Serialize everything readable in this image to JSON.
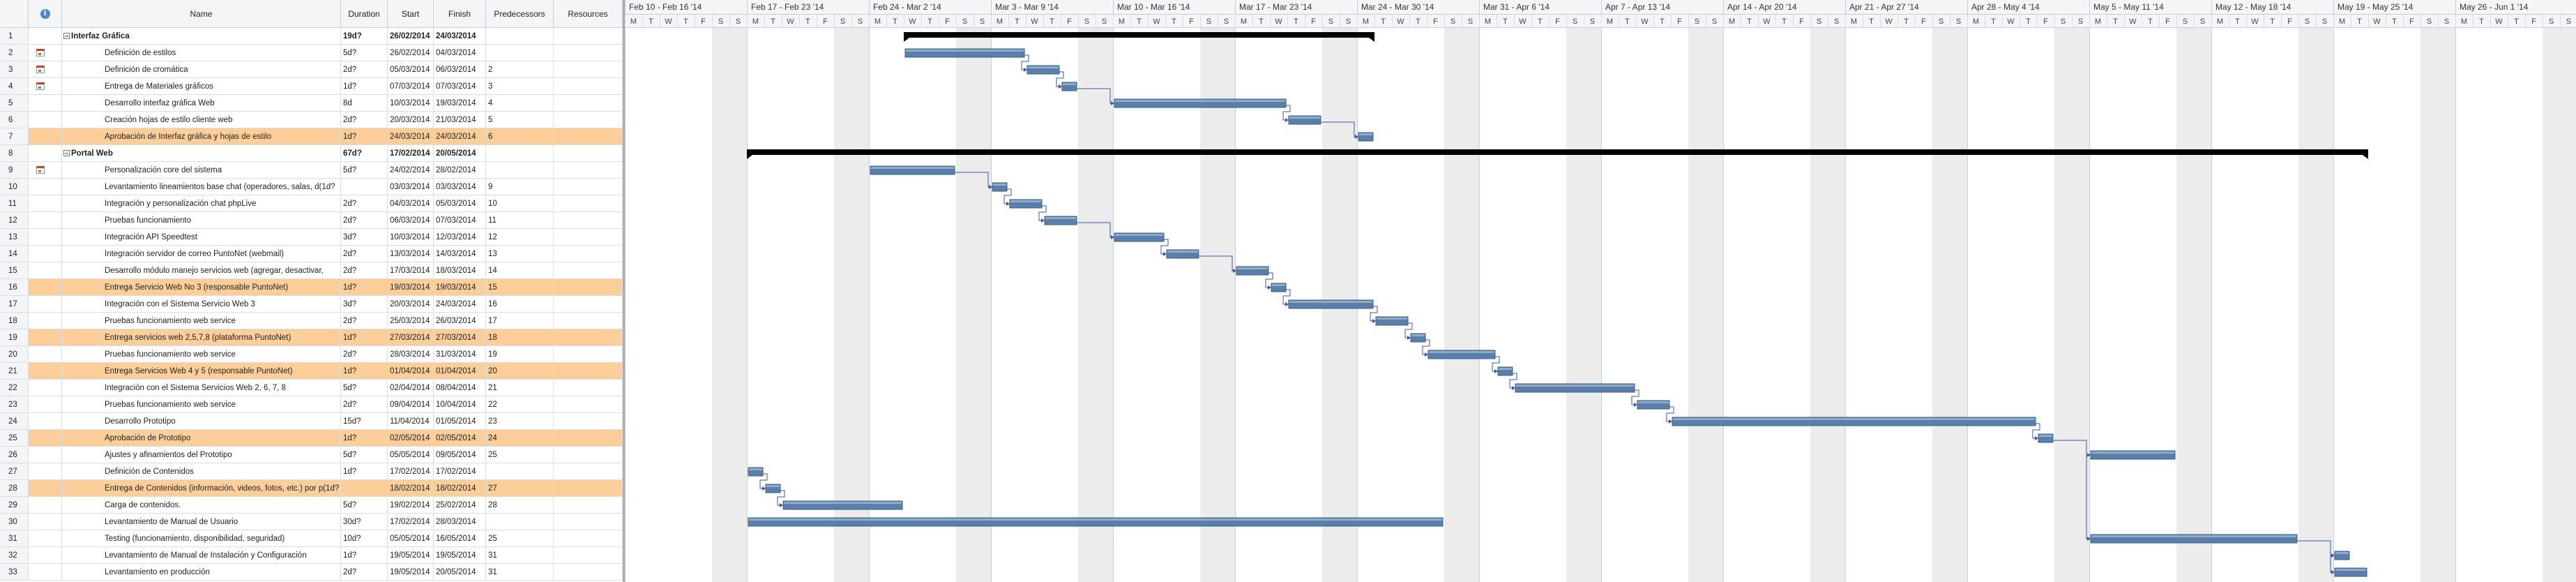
{
  "header": {
    "id_col": "",
    "info_icon": "i",
    "name_col": "Name",
    "duration_col": "Duration",
    "start_col": "Start",
    "finish_col": "Finish",
    "pred_col": "Predecessors",
    "res_col": "Resources"
  },
  "icons": {
    "info": "info-icon",
    "indicator": "calendar-note-icon",
    "collapse": "collapse-toggle-icon"
  },
  "colors": {
    "selected_row": "#fccf9a",
    "task_bar": "#5a7fa8",
    "summary_bar": "#000000",
    "weekend": "#ececec",
    "link": "#3e57a3"
  },
  "timeline": {
    "weeks": [
      "Feb 10 - Feb 16 '14",
      "Feb 17 - Feb 23 '14",
      "Feb 24 - Mar 2 '14",
      "Mar 3 - Mar 9 '14",
      "Mar 10 - Mar 16 '14",
      "Mar 17 - Mar 23 '14",
      "Mar 24 - Mar 30 '14",
      "Mar 31 - Apr 6 '14",
      "Apr 7 - Apr 13 '14",
      "Apr 14 - Apr 20 '14",
      "Apr 21 - Apr 27 '14",
      "Apr 28 - May 4 '14",
      "May 5 - May 11 '14",
      "May 12 - May 18 '14",
      "May 19 - May 25 '14",
      "May 26 - Jun 1 '14"
    ],
    "days": [
      "M",
      "T",
      "W",
      "T",
      "F",
      "S",
      "S"
    ],
    "first_day": "2014-02-10"
  },
  "rows": [
    {
      "id": "1",
      "name": "Interfaz Gráfica",
      "duration": "19d?",
      "start": "26/02/2014",
      "finish": "24/03/2014",
      "pred": "",
      "res": "",
      "summary": true,
      "indicator": false,
      "sel": false
    },
    {
      "id": "2",
      "name": "Definición de estilos",
      "duration": "5d?",
      "start": "26/02/2014",
      "finish": "04/03/2014",
      "pred": "",
      "res": "",
      "summary": false,
      "indicator": true,
      "sel": false
    },
    {
      "id": "3",
      "name": "Definición de cromática",
      "duration": "2d?",
      "start": "05/03/2014",
      "finish": "06/03/2014",
      "pred": "2",
      "res": "",
      "summary": false,
      "indicator": true,
      "sel": false
    },
    {
      "id": "4",
      "name": "Entrega de Materiales gráficos",
      "duration": "1d?",
      "start": "07/03/2014",
      "finish": "07/03/2014",
      "pred": "3",
      "res": "",
      "summary": false,
      "indicator": true,
      "sel": false
    },
    {
      "id": "5",
      "name": "Desarrollo interfaz gráfica Web",
      "duration": "8d",
      "start": "10/03/2014",
      "finish": "19/03/2014",
      "pred": "4",
      "res": "",
      "summary": false,
      "indicator": false,
      "sel": false
    },
    {
      "id": "6",
      "name": "Creación hojas de estilo cliente web",
      "duration": "2d?",
      "start": "20/03/2014",
      "finish": "21/03/2014",
      "pred": "5",
      "res": "",
      "summary": false,
      "indicator": false,
      "sel": false
    },
    {
      "id": "7",
      "name": "Aprobación de Interfaz gráfica y hojas de estilo",
      "duration": "1d?",
      "start": "24/03/2014",
      "finish": "24/03/2014",
      "pred": "6",
      "res": "",
      "summary": false,
      "indicator": false,
      "sel": true
    },
    {
      "id": "8",
      "name": "Portal Web",
      "duration": "67d?",
      "start": "17/02/2014",
      "finish": "20/05/2014",
      "pred": "",
      "res": "",
      "summary": true,
      "indicator": false,
      "sel": false
    },
    {
      "id": "9",
      "name": "Personalización core del sistema",
      "duration": "5d?",
      "start": "24/02/2014",
      "finish": "28/02/2014",
      "pred": "",
      "res": "",
      "summary": false,
      "indicator": true,
      "sel": false
    },
    {
      "id": "10",
      "name": "Levantamiento lineamientos base chat (operadores, salas, d(1d?",
      "duration": "",
      "start": "03/03/2014",
      "finish": "03/03/2014",
      "pred": "9",
      "res": "",
      "summary": false,
      "indicator": false,
      "sel": false
    },
    {
      "id": "11",
      "name": "Integración y personalización chat phpLive",
      "duration": "2d?",
      "start": "04/03/2014",
      "finish": "05/03/2014",
      "pred": "10",
      "res": "",
      "summary": false,
      "indicator": false,
      "sel": false
    },
    {
      "id": "12",
      "name": "Pruebas funcionamiento",
      "duration": "2d?",
      "start": "06/03/2014",
      "finish": "07/03/2014",
      "pred": "11",
      "res": "",
      "summary": false,
      "indicator": false,
      "sel": false
    },
    {
      "id": "13",
      "name": "Integración API Speedtest",
      "duration": "3d?",
      "start": "10/03/2014",
      "finish": "12/03/2014",
      "pred": "12",
      "res": "",
      "summary": false,
      "indicator": false,
      "sel": false
    },
    {
      "id": "14",
      "name": "Integración servidor de correo PuntoNet (webmail)",
      "duration": "2d?",
      "start": "13/03/2014",
      "finish": "14/03/2014",
      "pred": "13",
      "res": "",
      "summary": false,
      "indicator": false,
      "sel": false
    },
    {
      "id": "15",
      "name": "Desarrollo módulo manejo servicios web (agregar, desactivar,",
      "duration": "2d?",
      "start": "17/03/2014",
      "finish": "18/03/2014",
      "pred": "14",
      "res": "",
      "summary": false,
      "indicator": false,
      "sel": false
    },
    {
      "id": "16",
      "name": "Entrega Servicio Web No 3 (responsable PuntoNet)",
      "duration": "1d?",
      "start": "19/03/2014",
      "finish": "19/03/2014",
      "pred": "15",
      "res": "",
      "summary": false,
      "indicator": false,
      "sel": true
    },
    {
      "id": "17",
      "name": "Integración con el Sistema Servicio Web 3",
      "duration": "3d?",
      "start": "20/03/2014",
      "finish": "24/03/2014",
      "pred": "16",
      "res": "",
      "summary": false,
      "indicator": false,
      "sel": false
    },
    {
      "id": "18",
      "name": "Pruebas funcionamiento web service",
      "duration": "2d?",
      "start": "25/03/2014",
      "finish": "26/03/2014",
      "pred": "17",
      "res": "",
      "summary": false,
      "indicator": false,
      "sel": false
    },
    {
      "id": "19",
      "name": "Entrega servicios web 2,5,7,8 (plataforma PuntoNet)",
      "duration": "1d?",
      "start": "27/03/2014",
      "finish": "27/03/2014",
      "pred": "18",
      "res": "",
      "summary": false,
      "indicator": false,
      "sel": true
    },
    {
      "id": "20",
      "name": "Pruebas funcionamiento web service",
      "duration": "2d?",
      "start": "28/03/2014",
      "finish": "31/03/2014",
      "pred": "19",
      "res": "",
      "summary": false,
      "indicator": false,
      "sel": false
    },
    {
      "id": "21",
      "name": "Entrega Servicios Web 4 y 5 (responsable PuntoNet)",
      "duration": "1d?",
      "start": "01/04/2014",
      "finish": "01/04/2014",
      "pred": "20",
      "res": "",
      "summary": false,
      "indicator": false,
      "sel": true
    },
    {
      "id": "22",
      "name": "Integración con el Sistema Servicios Web 2, 6, 7, 8",
      "duration": "5d?",
      "start": "02/04/2014",
      "finish": "08/04/2014",
      "pred": "21",
      "res": "",
      "summary": false,
      "indicator": false,
      "sel": false
    },
    {
      "id": "23",
      "name": "Pruebas funcionamiento web service",
      "duration": "2d?",
      "start": "09/04/2014",
      "finish": "10/04/2014",
      "pred": "22",
      "res": "",
      "summary": false,
      "indicator": false,
      "sel": false
    },
    {
      "id": "24",
      "name": "Desarrollo Prototipo",
      "duration": "15d?",
      "start": "11/04/2014",
      "finish": "01/05/2014",
      "pred": "23",
      "res": "",
      "summary": false,
      "indicator": false,
      "sel": false
    },
    {
      "id": "25",
      "name": "Aprobación de Prototipo",
      "duration": "1d?",
      "start": "02/05/2014",
      "finish": "02/05/2014",
      "pred": "24",
      "res": "",
      "summary": false,
      "indicator": false,
      "sel": true
    },
    {
      "id": "26",
      "name": "Ajustes y afinamientos del Prototipo",
      "duration": "5d?",
      "start": "05/05/2014",
      "finish": "09/05/2014",
      "pred": "25",
      "res": "",
      "summary": false,
      "indicator": false,
      "sel": false
    },
    {
      "id": "27",
      "name": "Definición de Contenidos",
      "duration": "1d?",
      "start": "17/02/2014",
      "finish": "17/02/2014",
      "pred": "",
      "res": "",
      "summary": false,
      "indicator": false,
      "sel": false
    },
    {
      "id": "28",
      "name": "Entrega de Contenidos (información, videos, fotos, etc.) por p(1d?",
      "duration": "",
      "start": "18/02/2014",
      "finish": "18/02/2014",
      "pred": "27",
      "res": "",
      "summary": false,
      "indicator": false,
      "sel": true
    },
    {
      "id": "29",
      "name": "Carga de contenidos.",
      "duration": "5d?",
      "start": "19/02/2014",
      "finish": "25/02/2014",
      "pred": "28",
      "res": "",
      "summary": false,
      "indicator": false,
      "sel": false
    },
    {
      "id": "30",
      "name": "Levantamiento de Manual de Usuario",
      "duration": "30d?",
      "start": "17/02/2014",
      "finish": "28/03/2014",
      "pred": "",
      "res": "",
      "summary": false,
      "indicator": false,
      "sel": false
    },
    {
      "id": "31",
      "name": "Testing (funcionamiento, disponibilidad, seguridad)",
      "duration": "10d?",
      "start": "05/05/2014",
      "finish": "16/05/2014",
      "pred": "25",
      "res": "",
      "summary": false,
      "indicator": false,
      "sel": false
    },
    {
      "id": "32",
      "name": "Levantamiento de Manual de Instalación y Configuración",
      "duration": "1d?",
      "start": "19/05/2014",
      "finish": "19/05/2014",
      "pred": "31",
      "res": "",
      "summary": false,
      "indicator": false,
      "sel": false
    },
    {
      "id": "33",
      "name": "Levantamiento en producción",
      "duration": "2d?",
      "start": "19/05/2014",
      "finish": "20/05/2014",
      "pred": "31",
      "res": "",
      "summary": false,
      "indicator": false,
      "sel": false
    }
  ]
}
